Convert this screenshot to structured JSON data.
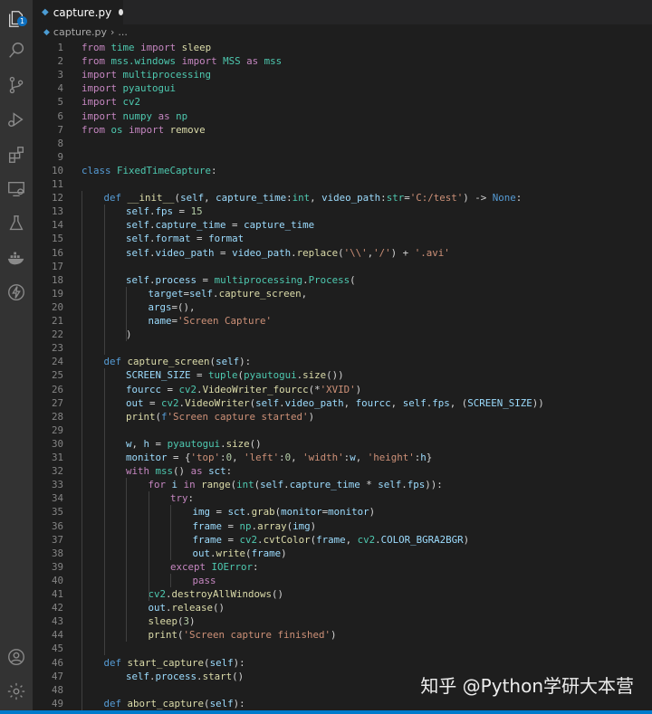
{
  "tab": {
    "title": "capture.py"
  },
  "breadcrumb": {
    "file": "capture.py",
    "more": "..."
  },
  "activity": {
    "explorer_badge": "1"
  },
  "watermark": "知乎 @Python学研大本营",
  "lines": [
    {
      "n": "1",
      "i": 0,
      "t": [
        [
          "kw",
          "from"
        ],
        [
          "p",
          " "
        ],
        [
          "cls",
          "time"
        ],
        [
          "p",
          " "
        ],
        [
          "kw",
          "import"
        ],
        [
          "p",
          " "
        ],
        [
          "fn",
          "sleep"
        ]
      ]
    },
    {
      "n": "2",
      "i": 0,
      "t": [
        [
          "kw",
          "from"
        ],
        [
          "p",
          " "
        ],
        [
          "cls",
          "mss.windows"
        ],
        [
          "p",
          " "
        ],
        [
          "kw",
          "import"
        ],
        [
          "p",
          " "
        ],
        [
          "cls",
          "MSS"
        ],
        [
          "p",
          " "
        ],
        [
          "kw",
          "as"
        ],
        [
          "p",
          " "
        ],
        [
          "cls",
          "mss"
        ]
      ]
    },
    {
      "n": "3",
      "i": 0,
      "t": [
        [
          "kw",
          "import"
        ],
        [
          "p",
          " "
        ],
        [
          "cls",
          "multiprocessing"
        ]
      ]
    },
    {
      "n": "4",
      "i": 0,
      "t": [
        [
          "kw",
          "import"
        ],
        [
          "p",
          " "
        ],
        [
          "cls",
          "pyautogui"
        ]
      ]
    },
    {
      "n": "5",
      "i": 0,
      "t": [
        [
          "kw",
          "import"
        ],
        [
          "p",
          " "
        ],
        [
          "cls",
          "cv2"
        ]
      ]
    },
    {
      "n": "6",
      "i": 0,
      "t": [
        [
          "kw",
          "import"
        ],
        [
          "p",
          " "
        ],
        [
          "cls",
          "numpy"
        ],
        [
          "p",
          " "
        ],
        [
          "kw",
          "as"
        ],
        [
          "p",
          " "
        ],
        [
          "cls",
          "np"
        ]
      ]
    },
    {
      "n": "7",
      "i": 0,
      "t": [
        [
          "kw",
          "from"
        ],
        [
          "p",
          " "
        ],
        [
          "cls",
          "os"
        ],
        [
          "p",
          " "
        ],
        [
          "kw",
          "import"
        ],
        [
          "p",
          " "
        ],
        [
          "fn",
          "remove"
        ]
      ]
    },
    {
      "n": "8",
      "i": 0,
      "t": []
    },
    {
      "n": "9",
      "i": 0,
      "t": []
    },
    {
      "n": "10",
      "i": 0,
      "t": [
        [
          "def",
          "class"
        ],
        [
          "p",
          " "
        ],
        [
          "cls",
          "FixedTimeCapture"
        ],
        [
          "p",
          ":"
        ]
      ]
    },
    {
      "n": "11",
      "i": 0,
      "t": []
    },
    {
      "n": "12",
      "i": 1,
      "t": [
        [
          "def",
          "def"
        ],
        [
          "p",
          " "
        ],
        [
          "fn",
          "__init__"
        ],
        [
          "p",
          "("
        ],
        [
          "var",
          "self"
        ],
        [
          "p",
          ", "
        ],
        [
          "var",
          "capture_time"
        ],
        [
          "p",
          ":"
        ],
        [
          "cls",
          "int"
        ],
        [
          "p",
          ", "
        ],
        [
          "var",
          "video_path"
        ],
        [
          "p",
          ":"
        ],
        [
          "cls",
          "str"
        ],
        [
          "p",
          "="
        ],
        [
          "str",
          "'C:/test'"
        ],
        [
          "p",
          ") -> "
        ],
        [
          "def",
          "None"
        ],
        [
          "p",
          ":"
        ]
      ]
    },
    {
      "n": "13",
      "i": 2,
      "t": [
        [
          "var",
          "self"
        ],
        [
          "p",
          "."
        ],
        [
          "var",
          "fps"
        ],
        [
          "p",
          " = "
        ],
        [
          "num",
          "15"
        ]
      ]
    },
    {
      "n": "14",
      "i": 2,
      "t": [
        [
          "var",
          "self"
        ],
        [
          "p",
          "."
        ],
        [
          "var",
          "capture_time"
        ],
        [
          "p",
          " = "
        ],
        [
          "var",
          "capture_time"
        ]
      ]
    },
    {
      "n": "15",
      "i": 2,
      "t": [
        [
          "var",
          "self"
        ],
        [
          "p",
          "."
        ],
        [
          "var",
          "format"
        ],
        [
          "p",
          " = "
        ],
        [
          "var",
          "format"
        ]
      ]
    },
    {
      "n": "16",
      "i": 2,
      "t": [
        [
          "var",
          "self"
        ],
        [
          "p",
          "."
        ],
        [
          "var",
          "video_path"
        ],
        [
          "p",
          " = "
        ],
        [
          "var",
          "video_path"
        ],
        [
          "p",
          "."
        ],
        [
          "fn",
          "replace"
        ],
        [
          "p",
          "("
        ],
        [
          "str",
          "'\\\\'"
        ],
        [
          "p",
          ","
        ],
        [
          "str",
          "'/'"
        ],
        [
          "p",
          ") + "
        ],
        [
          "str",
          "'.avi'"
        ]
      ]
    },
    {
      "n": "17",
      "i": 0,
      "t": []
    },
    {
      "n": "18",
      "i": 2,
      "t": [
        [
          "var",
          "self"
        ],
        [
          "p",
          "."
        ],
        [
          "var",
          "process"
        ],
        [
          "p",
          " = "
        ],
        [
          "cls",
          "multiprocessing"
        ],
        [
          "p",
          "."
        ],
        [
          "cls",
          "Process"
        ],
        [
          "p",
          "("
        ]
      ]
    },
    {
      "n": "19",
      "i": 3,
      "t": [
        [
          "var",
          "target"
        ],
        [
          "p",
          "="
        ],
        [
          "var",
          "self"
        ],
        [
          "p",
          "."
        ],
        [
          "fn",
          "capture_screen"
        ],
        [
          "p",
          ","
        ]
      ]
    },
    {
      "n": "20",
      "i": 3,
      "t": [
        [
          "var",
          "args"
        ],
        [
          "p",
          "=(),"
        ]
      ]
    },
    {
      "n": "21",
      "i": 3,
      "t": [
        [
          "var",
          "name"
        ],
        [
          "p",
          "="
        ],
        [
          "str",
          "'Screen Capture'"
        ]
      ]
    },
    {
      "n": "22",
      "i": 2,
      "t": [
        [
          "p",
          ")"
        ]
      ]
    },
    {
      "n": "23",
      "i": 0,
      "t": []
    },
    {
      "n": "24",
      "i": 1,
      "t": [
        [
          "def",
          "def"
        ],
        [
          "p",
          " "
        ],
        [
          "fn",
          "capture_screen"
        ],
        [
          "p",
          "("
        ],
        [
          "var",
          "self"
        ],
        [
          "p",
          "):"
        ]
      ]
    },
    {
      "n": "25",
      "i": 2,
      "t": [
        [
          "var",
          "SCREEN_SIZE"
        ],
        [
          "p",
          " = "
        ],
        [
          "cls",
          "tuple"
        ],
        [
          "p",
          "("
        ],
        [
          "cls",
          "pyautogui"
        ],
        [
          "p",
          "."
        ],
        [
          "fn",
          "size"
        ],
        [
          "p",
          "())"
        ]
      ]
    },
    {
      "n": "26",
      "i": 2,
      "t": [
        [
          "var",
          "fourcc"
        ],
        [
          "p",
          " = "
        ],
        [
          "cls",
          "cv2"
        ],
        [
          "p",
          "."
        ],
        [
          "fn",
          "VideoWriter_fourcc"
        ],
        [
          "p",
          "(*"
        ],
        [
          "str",
          "'XVID'"
        ],
        [
          "p",
          ")"
        ]
      ]
    },
    {
      "n": "27",
      "i": 2,
      "t": [
        [
          "var",
          "out"
        ],
        [
          "p",
          " = "
        ],
        [
          "cls",
          "cv2"
        ],
        [
          "p",
          "."
        ],
        [
          "fn",
          "VideoWriter"
        ],
        [
          "p",
          "("
        ],
        [
          "var",
          "self"
        ],
        [
          "p",
          "."
        ],
        [
          "var",
          "video_path"
        ],
        [
          "p",
          ", "
        ],
        [
          "var",
          "fourcc"
        ],
        [
          "p",
          ", "
        ],
        [
          "var",
          "self"
        ],
        [
          "p",
          "."
        ],
        [
          "var",
          "fps"
        ],
        [
          "p",
          ", ("
        ],
        [
          "var",
          "SCREEN_SIZE"
        ],
        [
          "p",
          "))"
        ]
      ]
    },
    {
      "n": "28",
      "i": 2,
      "t": [
        [
          "fn",
          "print"
        ],
        [
          "p",
          "("
        ],
        [
          "def",
          "f"
        ],
        [
          "str",
          "'Screen capture started'"
        ],
        [
          "p",
          ")"
        ]
      ]
    },
    {
      "n": "29",
      "i": 0,
      "t": []
    },
    {
      "n": "30",
      "i": 2,
      "t": [
        [
          "var",
          "w"
        ],
        [
          "p",
          ", "
        ],
        [
          "var",
          "h"
        ],
        [
          "p",
          " = "
        ],
        [
          "cls",
          "pyautogui"
        ],
        [
          "p",
          "."
        ],
        [
          "fn",
          "size"
        ],
        [
          "p",
          "()"
        ]
      ]
    },
    {
      "n": "31",
      "i": 2,
      "t": [
        [
          "var",
          "monitor"
        ],
        [
          "p",
          " = {"
        ],
        [
          "str",
          "'top'"
        ],
        [
          "p",
          ":"
        ],
        [
          "num",
          "0"
        ],
        [
          "p",
          ", "
        ],
        [
          "str",
          "'left'"
        ],
        [
          "p",
          ":"
        ],
        [
          "num",
          "0"
        ],
        [
          "p",
          ", "
        ],
        [
          "str",
          "'width'"
        ],
        [
          "p",
          ":"
        ],
        [
          "var",
          "w"
        ],
        [
          "p",
          ", "
        ],
        [
          "str",
          "'height'"
        ],
        [
          "p",
          ":"
        ],
        [
          "var",
          "h"
        ],
        [
          "p",
          "}"
        ]
      ]
    },
    {
      "n": "32",
      "i": 2,
      "t": [
        [
          "kw",
          "with"
        ],
        [
          "p",
          " "
        ],
        [
          "cls",
          "mss"
        ],
        [
          "p",
          "() "
        ],
        [
          "kw",
          "as"
        ],
        [
          "p",
          " "
        ],
        [
          "var",
          "sct"
        ],
        [
          "p",
          ":"
        ]
      ]
    },
    {
      "n": "33",
      "i": 3,
      "t": [
        [
          "kw",
          "for"
        ],
        [
          "p",
          " "
        ],
        [
          "var",
          "i"
        ],
        [
          "p",
          " "
        ],
        [
          "kw",
          "in"
        ],
        [
          "p",
          " "
        ],
        [
          "fn",
          "range"
        ],
        [
          "p",
          "("
        ],
        [
          "cls",
          "int"
        ],
        [
          "p",
          "("
        ],
        [
          "var",
          "self"
        ],
        [
          "p",
          "."
        ],
        [
          "var",
          "capture_time"
        ],
        [
          "p",
          " * "
        ],
        [
          "var",
          "self"
        ],
        [
          "p",
          "."
        ],
        [
          "var",
          "fps"
        ],
        [
          "p",
          "))"
        ],
        [
          "p",
          ":"
        ]
      ]
    },
    {
      "n": "34",
      "i": 4,
      "t": [
        [
          "kw",
          "try"
        ],
        [
          "p",
          ":"
        ]
      ]
    },
    {
      "n": "35",
      "i": 5,
      "t": [
        [
          "var",
          "img"
        ],
        [
          "p",
          " = "
        ],
        [
          "var",
          "sct"
        ],
        [
          "p",
          "."
        ],
        [
          "fn",
          "grab"
        ],
        [
          "p",
          "("
        ],
        [
          "var",
          "monitor"
        ],
        [
          "p",
          "="
        ],
        [
          "var",
          "monitor"
        ],
        [
          "p",
          ")"
        ]
      ]
    },
    {
      "n": "36",
      "i": 5,
      "t": [
        [
          "var",
          "frame"
        ],
        [
          "p",
          " = "
        ],
        [
          "cls",
          "np"
        ],
        [
          "p",
          "."
        ],
        [
          "fn",
          "array"
        ],
        [
          "p",
          "("
        ],
        [
          "var",
          "img"
        ],
        [
          "p",
          ")"
        ]
      ]
    },
    {
      "n": "37",
      "i": 5,
      "t": [
        [
          "var",
          "frame"
        ],
        [
          "p",
          " = "
        ],
        [
          "cls",
          "cv2"
        ],
        [
          "p",
          "."
        ],
        [
          "fn",
          "cvtColor"
        ],
        [
          "p",
          "("
        ],
        [
          "var",
          "frame"
        ],
        [
          "p",
          ", "
        ],
        [
          "cls",
          "cv2"
        ],
        [
          "p",
          "."
        ],
        [
          "var",
          "COLOR_BGRA2BGR"
        ],
        [
          "p",
          ")"
        ]
      ]
    },
    {
      "n": "38",
      "i": 5,
      "t": [
        [
          "var",
          "out"
        ],
        [
          "p",
          "."
        ],
        [
          "fn",
          "write"
        ],
        [
          "p",
          "("
        ],
        [
          "var",
          "frame"
        ],
        [
          "p",
          ")"
        ]
      ]
    },
    {
      "n": "39",
      "i": 4,
      "t": [
        [
          "kw",
          "except"
        ],
        [
          "p",
          " "
        ],
        [
          "cls",
          "IOError"
        ],
        [
          "p",
          ":"
        ]
      ]
    },
    {
      "n": "40",
      "i": 5,
      "t": [
        [
          "kw",
          "pass"
        ]
      ]
    },
    {
      "n": "41",
      "i": 3,
      "t": [
        [
          "cls",
          "cv2"
        ],
        [
          "p",
          "."
        ],
        [
          "fn",
          "destroyAllWindows"
        ],
        [
          "p",
          "()"
        ]
      ]
    },
    {
      "n": "42",
      "i": 3,
      "t": [
        [
          "var",
          "out"
        ],
        [
          "p",
          "."
        ],
        [
          "fn",
          "release"
        ],
        [
          "p",
          "()"
        ]
      ]
    },
    {
      "n": "43",
      "i": 3,
      "t": [
        [
          "fn",
          "sleep"
        ],
        [
          "p",
          "("
        ],
        [
          "num",
          "3"
        ],
        [
          "p",
          ")"
        ]
      ]
    },
    {
      "n": "44",
      "i": 3,
      "t": [
        [
          "fn",
          "print"
        ],
        [
          "p",
          "("
        ],
        [
          "str",
          "'Screen capture finished'"
        ],
        [
          "p",
          ")"
        ]
      ]
    },
    {
      "n": "45",
      "i": 0,
      "t": []
    },
    {
      "n": "46",
      "i": 1,
      "t": [
        [
          "def",
          "def"
        ],
        [
          "p",
          " "
        ],
        [
          "fn",
          "start_capture"
        ],
        [
          "p",
          "("
        ],
        [
          "var",
          "self"
        ],
        [
          "p",
          "):"
        ]
      ]
    },
    {
      "n": "47",
      "i": 2,
      "t": [
        [
          "var",
          "self"
        ],
        [
          "p",
          "."
        ],
        [
          "var",
          "process"
        ],
        [
          "p",
          "."
        ],
        [
          "fn",
          "start"
        ],
        [
          "p",
          "()"
        ]
      ]
    },
    {
      "n": "48",
      "i": 0,
      "t": []
    },
    {
      "n": "49",
      "i": 1,
      "t": [
        [
          "def",
          "def"
        ],
        [
          "p",
          " "
        ],
        [
          "fn",
          "abort_capture"
        ],
        [
          "p",
          "("
        ],
        [
          "var",
          "self"
        ],
        [
          "p",
          "):"
        ]
      ]
    }
  ]
}
